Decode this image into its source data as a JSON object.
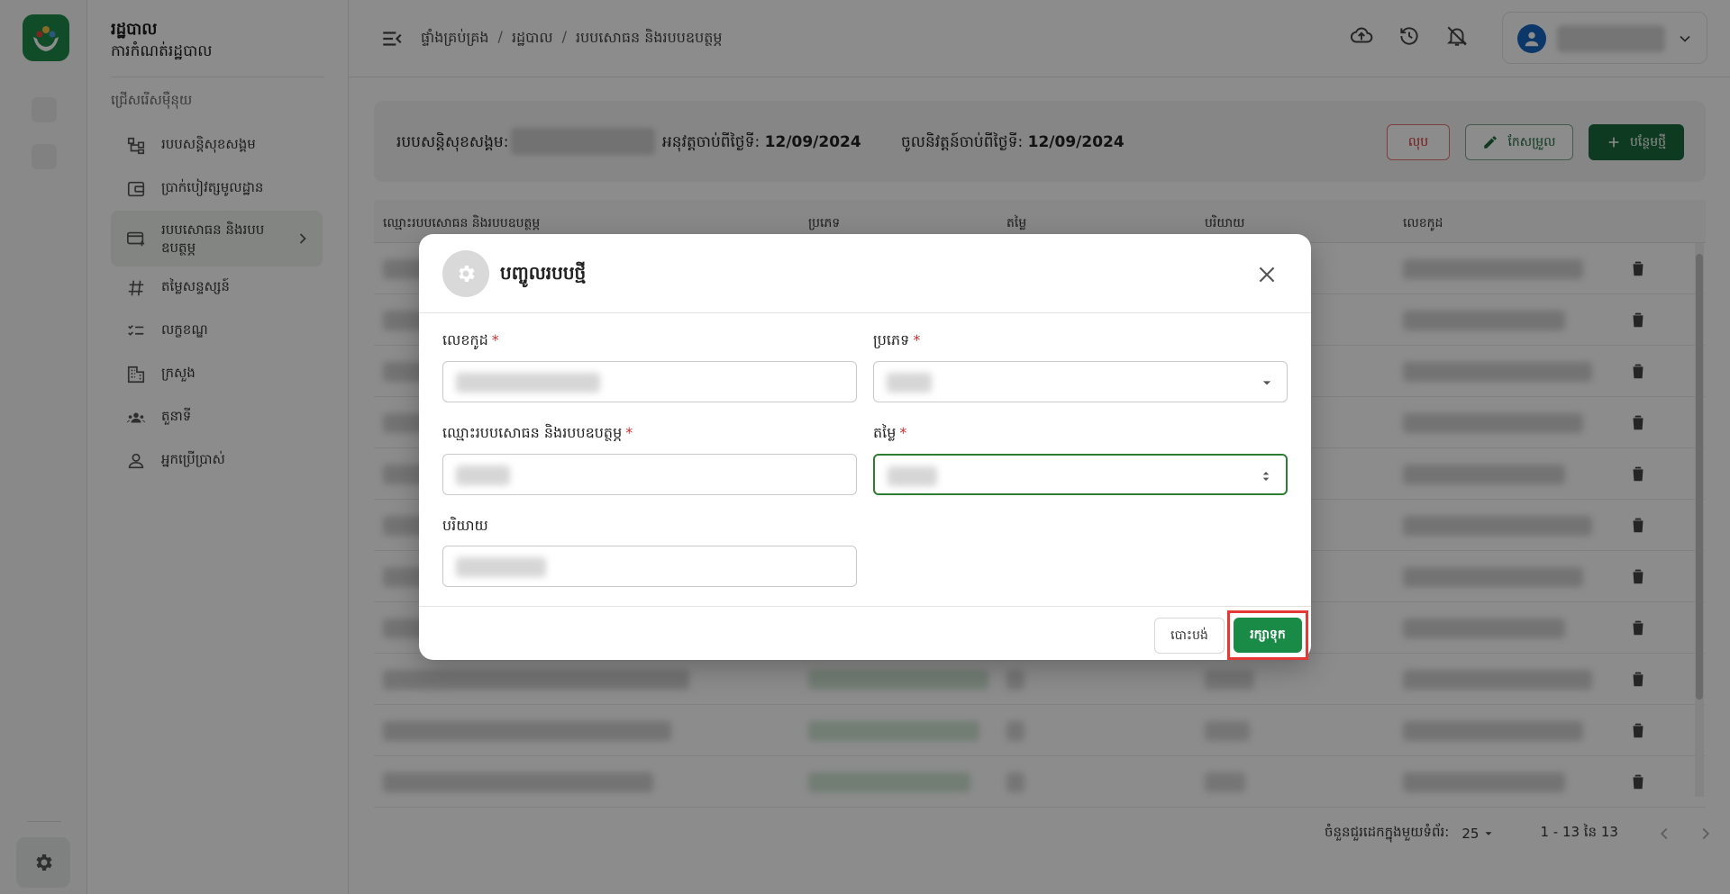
{
  "sidebar": {
    "org_title": "រដ្ឋបាល",
    "org_subtitle": "ការកំណត់រដ្ឋបាល",
    "section_label": "ជ្រើសរើសម៉ឺនុយ",
    "items": [
      {
        "label": "របបសន្តិសុខសង្គម",
        "icon": "hierarchy-icon"
      },
      {
        "label": "ប្រាក់បៀវត្សមូលដ្ឋាន",
        "icon": "wallet-icon"
      },
      {
        "label": "របបសោធន និងរបបឧបត្ថម្ភ",
        "icon": "card-add-icon"
      },
      {
        "label": "តម្លៃសន្ទស្សន៍",
        "icon": "hash-icon"
      },
      {
        "label": "លក្ខខណ្ឌ",
        "icon": "checklist-icon"
      },
      {
        "label": "ក្រសួង",
        "icon": "building-icon"
      },
      {
        "label": "តួនាទី",
        "icon": "group-icon"
      },
      {
        "label": "អ្នកប្រើប្រាស់",
        "icon": "person-icon"
      }
    ]
  },
  "topbar": {
    "breadcrumb": [
      "ផ្ទាំងគ្រប់គ្រង",
      "រដ្ឋបាល",
      "របបសោធន និងរបបឧបត្ថម្ភ"
    ]
  },
  "info": {
    "scheme_label": "របបសន្តិសុខសង្គម:",
    "effective_label": "អនុវត្តចាប់ពីថ្ងៃទី:",
    "effective_date": "12/09/2024",
    "enforce_label": "ចូលនិវត្តន៍ចាប់ពីថ្ងៃទី:",
    "enforce_date": "12/09/2024",
    "delete_label": "លុប",
    "edit_label": "កែសម្រួល",
    "add_label": "បន្ថែមថ្មី"
  },
  "table": {
    "columns": [
      "ឈ្មោះរបបសោធន និងរបបឧបត្ថម្ភ",
      "ប្រភេទ",
      "តម្លៃ",
      "បរិយាយ",
      "លេខកូដ"
    ]
  },
  "pagination": {
    "rows_per_page_label": "ចំនួនជួរដេកក្នុងមួយទំព័រ:",
    "rows_per_page": "25",
    "range": "1 - 13 នៃ 13"
  },
  "dialog": {
    "title": "បញ្ចូលរបបថ្មី",
    "code_label": "លេខកូដ",
    "type_label": "ប្រភេទ",
    "name_label": "ឈ្មោះរបបសោធន និងរបបឧបត្ថម្ភ",
    "value_label": "តម្លៃ",
    "desc_label": "បរិយាយ",
    "required_mark": "*",
    "cancel_label": "បោះបង់",
    "save_label": "រក្សាទុក"
  },
  "colors": {
    "brand_green": "#1a6b3d",
    "save_green": "#1a8a47",
    "danger_red": "#d32f2f",
    "highlight_red": "#e53935"
  }
}
